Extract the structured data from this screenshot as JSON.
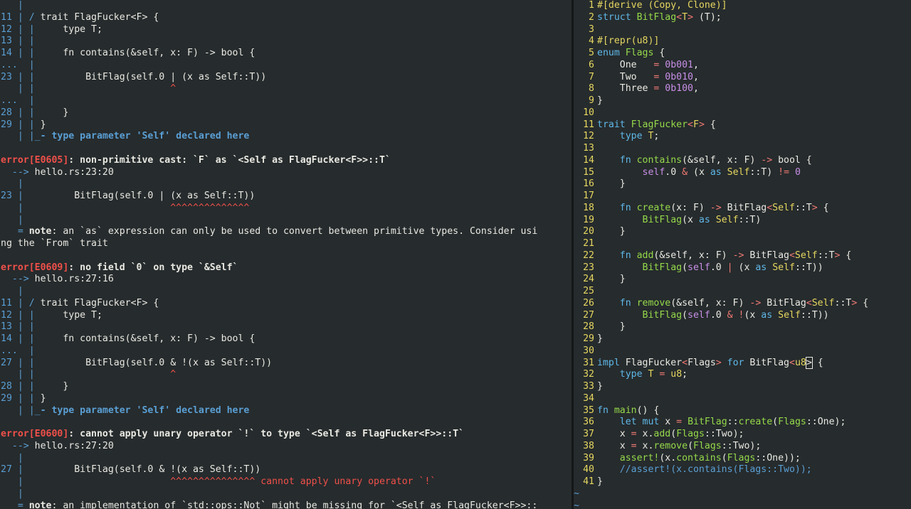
{
  "left_terminal": {
    "lines": [
      {
        "gutter": "   |",
        "text": ""
      },
      {
        "gutter": "11 | / ",
        "text": "trait FlagFucker<F> {"
      },
      {
        "gutter": "12 | | ",
        "text": "    type T;"
      },
      {
        "gutter": "13 | | ",
        "text": ""
      },
      {
        "gutter": "14 | | ",
        "text": "    fn contains(&self, x: F) -> bool {"
      },
      {
        "gutter": "...  |",
        "text": ""
      },
      {
        "gutter": "23 | | ",
        "text": "        BitFlag(self.0 | (x as Self::T))"
      },
      {
        "gutter": "   | | ",
        "mark": "                       ^"
      },
      {
        "gutter": "...  |",
        "text": ""
      },
      {
        "gutter": "28 | | ",
        "text": "    }"
      },
      {
        "gutter": "29 | | ",
        "text": "}"
      },
      {
        "gutter": "   | |_",
        "label": "- type parameter 'Self' declared here"
      },
      {
        "gutter": "",
        "text": ""
      },
      {
        "error": "error[E0605]",
        "header": ": non-primitive cast: `F` as `<Self as FlagFucker<F>>::T`"
      },
      {
        "gutter": "  --> ",
        "text": "hello.rs:23:20"
      },
      {
        "gutter": "   |",
        "text": ""
      },
      {
        "gutter": "23 | ",
        "text": "        BitFlag(self.0 | (x as Self::T))"
      },
      {
        "gutter": "   | ",
        "mark": "                         ^^^^^^^^^^^^^^"
      },
      {
        "gutter": "   |",
        "text": ""
      },
      {
        "gutter": "   = ",
        "note": "note",
        "text": ": an `as` expression can only be used to convert between primitive types. Consider usi"
      },
      {
        "gutter": "",
        "text": "ng the `From` trait"
      },
      {
        "gutter": "",
        "text": ""
      },
      {
        "error": "error[E0609]",
        "header": ": no field `0` on type `&Self`"
      },
      {
        "gutter": "  --> ",
        "text": "hello.rs:27:16"
      },
      {
        "gutter": "   |",
        "text": ""
      },
      {
        "gutter": "11 | / ",
        "text": "trait FlagFucker<F> {"
      },
      {
        "gutter": "12 | | ",
        "text": "    type T;"
      },
      {
        "gutter": "13 | | ",
        "text": ""
      },
      {
        "gutter": "14 | | ",
        "text": "    fn contains(&self, x: F) -> bool {"
      },
      {
        "gutter": "...  |",
        "text": ""
      },
      {
        "gutter": "27 | | ",
        "text": "        BitFlag(self.0 & !(x as Self::T))"
      },
      {
        "gutter": "   | | ",
        "mark": "                       ^"
      },
      {
        "gutter": "28 | | ",
        "text": "    }"
      },
      {
        "gutter": "29 | | ",
        "text": "}"
      },
      {
        "gutter": "   | |_",
        "label": "- type parameter 'Self' declared here"
      },
      {
        "gutter": "",
        "text": ""
      },
      {
        "error": "error[E0600]",
        "header": ": cannot apply unary operator `!` to type `<Self as FlagFucker<F>>::T`"
      },
      {
        "gutter": "  --> ",
        "text": "hello.rs:27:20"
      },
      {
        "gutter": "   |",
        "text": ""
      },
      {
        "gutter": "27 | ",
        "text": "        BitFlag(self.0 & !(x as Self::T))"
      },
      {
        "gutter": "   | ",
        "mark": "                         ^^^^^^^^^^^^^^^ cannot apply unary operator `!`"
      },
      {
        "gutter": "   |",
        "text": ""
      },
      {
        "gutter": "   = ",
        "note": "note",
        "text": ": an implementation of `std::ops::Not` might be missing for `<Self as FlagFucker<F>>::"
      }
    ]
  },
  "editor": {
    "lines": [
      {
        "n": "1",
        "toks": [
          [
            "ye",
            "#[derive (Copy, Clone)]"
          ]
        ]
      },
      {
        "n": "2",
        "toks": [
          [
            "kw",
            "struct "
          ],
          [
            "ty",
            "BitFlag"
          ],
          [
            "op",
            "<"
          ],
          [
            "ye",
            "T"
          ],
          [
            "op",
            "> "
          ],
          [
            "txt",
            "(T);"
          ]
        ]
      },
      {
        "n": "3",
        "toks": []
      },
      {
        "n": "4",
        "toks": [
          [
            "ye",
            "#[repr(u8)]"
          ]
        ]
      },
      {
        "n": "5",
        "toks": [
          [
            "kw",
            "enum "
          ],
          [
            "ty",
            "Flags "
          ],
          [
            "txt",
            "{"
          ]
        ]
      },
      {
        "n": "6",
        "toks": [
          [
            "txt",
            "    One   "
          ],
          [
            "op",
            "= "
          ],
          [
            "num",
            "0b001"
          ],
          [
            "txt",
            ","
          ]
        ]
      },
      {
        "n": "7",
        "toks": [
          [
            "txt",
            "    Two   "
          ],
          [
            "op",
            "= "
          ],
          [
            "num",
            "0b010"
          ],
          [
            "txt",
            ","
          ]
        ]
      },
      {
        "n": "8",
        "toks": [
          [
            "txt",
            "    Three "
          ],
          [
            "op",
            "= "
          ],
          [
            "num",
            "0b100"
          ],
          [
            "txt",
            ","
          ]
        ]
      },
      {
        "n": "9",
        "toks": [
          [
            "txt",
            "}"
          ]
        ]
      },
      {
        "n": "10",
        "toks": []
      },
      {
        "n": "11",
        "toks": [
          [
            "kw",
            "trait "
          ],
          [
            "ty",
            "FlagFucker"
          ],
          [
            "op",
            "<"
          ],
          [
            "ye",
            "F"
          ],
          [
            "op",
            "> "
          ],
          [
            "txt",
            "{"
          ]
        ]
      },
      {
        "n": "12",
        "toks": [
          [
            "kw",
            "    type "
          ],
          [
            "ye",
            "T"
          ],
          [
            "txt",
            ";"
          ]
        ]
      },
      {
        "n": "13",
        "toks": []
      },
      {
        "n": "14",
        "toks": [
          [
            "kw",
            "    fn "
          ],
          [
            "ty",
            "contains"
          ],
          [
            "txt",
            "(&self, x: F) "
          ],
          [
            "op",
            "-> "
          ],
          [
            "txt",
            "bool {"
          ]
        ]
      },
      {
        "n": "15",
        "toks": [
          [
            "num",
            "        self"
          ],
          [
            "txt",
            ".0 "
          ],
          [
            "op",
            "& "
          ],
          [
            "txt",
            "(x "
          ],
          [
            "kw",
            "as "
          ],
          [
            "ye",
            "Self"
          ],
          [
            "txt",
            "::T) "
          ],
          [
            "op",
            "!= "
          ],
          [
            "num",
            "0"
          ]
        ]
      },
      {
        "n": "16",
        "toks": [
          [
            "txt",
            "    }"
          ]
        ]
      },
      {
        "n": "17",
        "toks": []
      },
      {
        "n": "18",
        "toks": [
          [
            "kw",
            "    fn "
          ],
          [
            "ty",
            "create"
          ],
          [
            "txt",
            "(x: F) "
          ],
          [
            "op",
            "-> "
          ],
          [
            "txt",
            "BitFlag"
          ],
          [
            "op",
            "<"
          ],
          [
            "ye",
            "Self"
          ],
          [
            "txt",
            "::T"
          ],
          [
            "op",
            "> "
          ],
          [
            "txt",
            "{"
          ]
        ]
      },
      {
        "n": "19",
        "toks": [
          [
            "ty",
            "        BitFlag"
          ],
          [
            "txt",
            "(x "
          ],
          [
            "kw",
            "as "
          ],
          [
            "ye",
            "Self"
          ],
          [
            "txt",
            "::T)"
          ]
        ]
      },
      {
        "n": "20",
        "toks": [
          [
            "txt",
            "    }"
          ]
        ]
      },
      {
        "n": "21",
        "toks": []
      },
      {
        "n": "22",
        "toks": [
          [
            "kw",
            "    fn "
          ],
          [
            "ty",
            "add"
          ],
          [
            "txt",
            "(&self, x: F) "
          ],
          [
            "op",
            "-> "
          ],
          [
            "txt",
            "BitFlag"
          ],
          [
            "op",
            "<"
          ],
          [
            "ye",
            "Self"
          ],
          [
            "txt",
            "::T"
          ],
          [
            "op",
            "> "
          ],
          [
            "txt",
            "{"
          ]
        ]
      },
      {
        "n": "23",
        "toks": [
          [
            "ty",
            "        BitFlag"
          ],
          [
            "txt",
            "("
          ],
          [
            "num",
            "self"
          ],
          [
            "txt",
            ".0 "
          ],
          [
            "op",
            "| "
          ],
          [
            "txt",
            "(x "
          ],
          [
            "kw",
            "as "
          ],
          [
            "ye",
            "Self"
          ],
          [
            "txt",
            "::T))"
          ]
        ]
      },
      {
        "n": "24",
        "toks": [
          [
            "txt",
            "    }"
          ]
        ]
      },
      {
        "n": "25",
        "toks": []
      },
      {
        "n": "26",
        "toks": [
          [
            "kw",
            "    fn "
          ],
          [
            "ty",
            "remove"
          ],
          [
            "txt",
            "(&self, x: F) "
          ],
          [
            "op",
            "-> "
          ],
          [
            "txt",
            "BitFlag"
          ],
          [
            "op",
            "<"
          ],
          [
            "ye",
            "Self"
          ],
          [
            "txt",
            "::T"
          ],
          [
            "op",
            "> "
          ],
          [
            "txt",
            "{"
          ]
        ]
      },
      {
        "n": "27",
        "toks": [
          [
            "ty",
            "        BitFlag"
          ],
          [
            "txt",
            "("
          ],
          [
            "num",
            "self"
          ],
          [
            "txt",
            ".0 "
          ],
          [
            "op",
            "& !"
          ],
          [
            "txt",
            "(x "
          ],
          [
            "kw",
            "as "
          ],
          [
            "ye",
            "Self"
          ],
          [
            "txt",
            "::T))"
          ]
        ]
      },
      {
        "n": "28",
        "toks": [
          [
            "txt",
            "    }"
          ]
        ]
      },
      {
        "n": "29",
        "toks": [
          [
            "txt",
            "}"
          ]
        ]
      },
      {
        "n": "30",
        "toks": []
      },
      {
        "n": "31",
        "toks": [
          [
            "kw",
            "impl "
          ],
          [
            "txt",
            "FlagFucker"
          ],
          [
            "op",
            "<"
          ],
          [
            "txt",
            "Flags"
          ],
          [
            "op",
            "> "
          ],
          [
            "kw",
            "for "
          ],
          [
            "txt",
            "BitFlag"
          ],
          [
            "op",
            "<"
          ],
          [
            "ye",
            "u8"
          ],
          [
            "cursor",
            "&gt;"
          ],
          [
            "txt",
            " {"
          ]
        ]
      },
      {
        "n": "32",
        "toks": [
          [
            "kw",
            "    type "
          ],
          [
            "ye",
            "T "
          ],
          [
            "op",
            "= "
          ],
          [
            "ye",
            "u8"
          ],
          [
            "txt",
            ";"
          ]
        ]
      },
      {
        "n": "33",
        "toks": [
          [
            "txt",
            "}"
          ]
        ]
      },
      {
        "n": "34",
        "toks": []
      },
      {
        "n": "35",
        "toks": [
          [
            "kw",
            "fn "
          ],
          [
            "ty",
            "main"
          ],
          [
            "txt",
            "() {"
          ]
        ]
      },
      {
        "n": "36",
        "toks": [
          [
            "kw",
            "    let mut "
          ],
          [
            "txt",
            "x "
          ],
          [
            "op",
            "= "
          ],
          [
            "ty",
            "BitFlag"
          ],
          [
            "txt",
            "::"
          ],
          [
            "ty",
            "create"
          ],
          [
            "txt",
            "("
          ],
          [
            "ty",
            "Flags"
          ],
          [
            "txt",
            "::One);"
          ]
        ]
      },
      {
        "n": "37",
        "toks": [
          [
            "txt",
            "    x "
          ],
          [
            "op",
            "= "
          ],
          [
            "txt",
            "x."
          ],
          [
            "ty",
            "add"
          ],
          [
            "txt",
            "("
          ],
          [
            "ty",
            "Flags"
          ],
          [
            "txt",
            "::Two);"
          ]
        ]
      },
      {
        "n": "38",
        "toks": [
          [
            "txt",
            "    x "
          ],
          [
            "op",
            "= "
          ],
          [
            "txt",
            "x."
          ],
          [
            "ty",
            "remove"
          ],
          [
            "txt",
            "("
          ],
          [
            "ty",
            "Flags"
          ],
          [
            "txt",
            "::Two);"
          ]
        ]
      },
      {
        "n": "39",
        "toks": [
          [
            "ty",
            "    assert!"
          ],
          [
            "txt",
            "(x."
          ],
          [
            "ty",
            "contains"
          ],
          [
            "txt",
            "("
          ],
          [
            "ty",
            "Flags"
          ],
          [
            "txt",
            "::One));"
          ]
        ]
      },
      {
        "n": "40",
        "toks": [
          [
            "cm",
            "    //assert!(x.contains(Flags::Two));"
          ]
        ]
      },
      {
        "n": "41",
        "toks": [
          [
            "txt",
            "}"
          ]
        ]
      }
    ],
    "tildes": [
      "~",
      "~"
    ]
  }
}
